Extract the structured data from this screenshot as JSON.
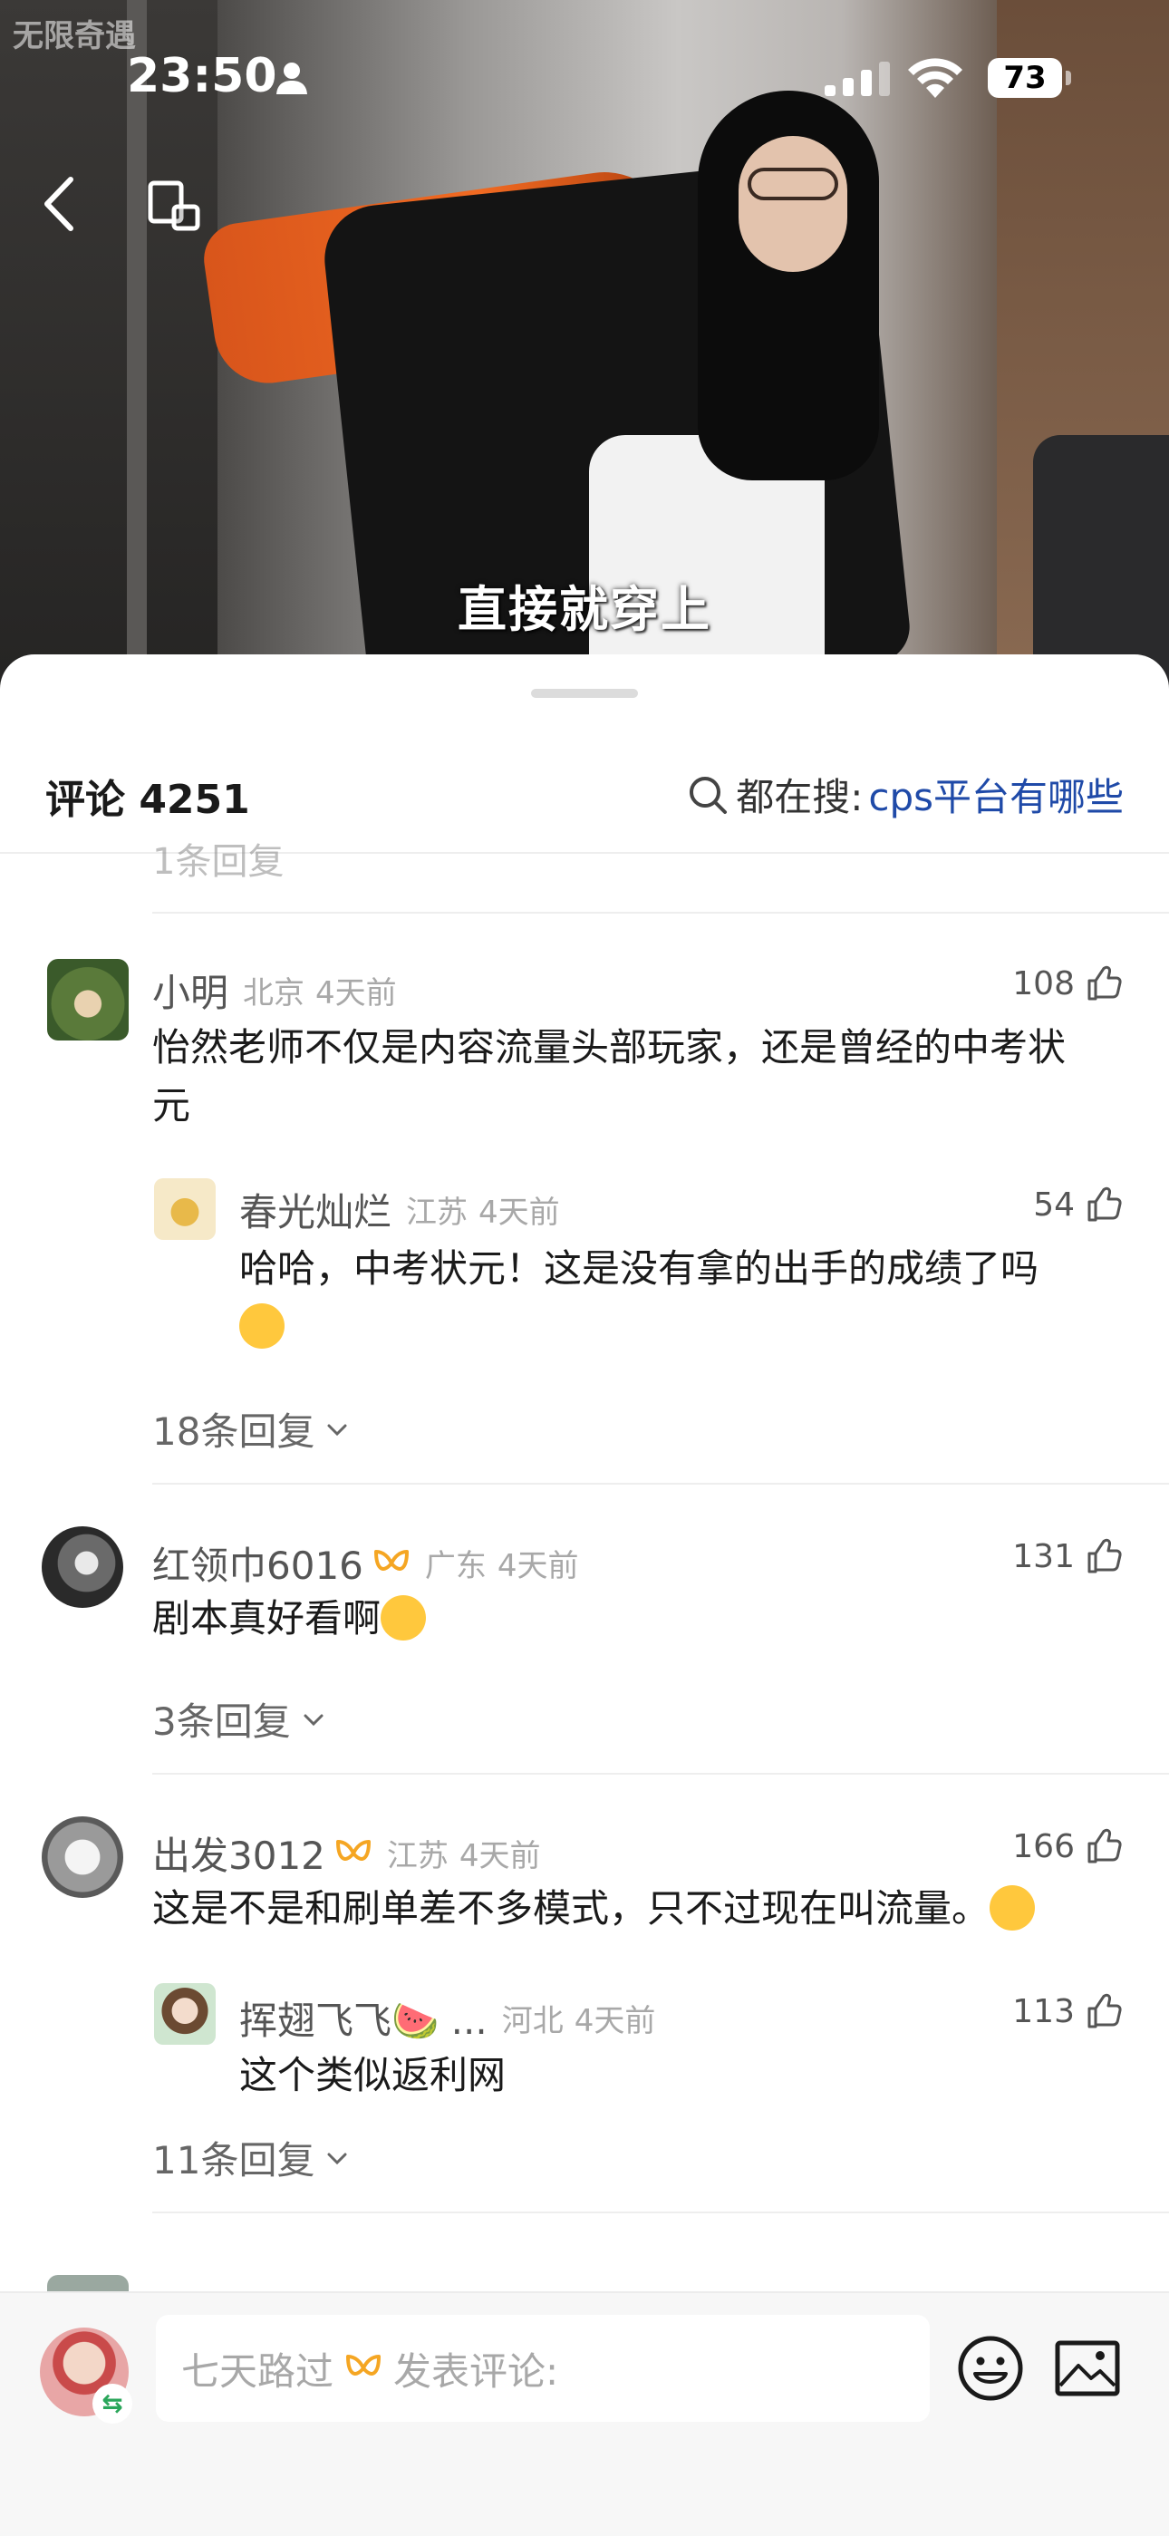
{
  "video": {
    "watermark": "无限奇遇",
    "subtitle": "直接就穿上"
  },
  "status_bar": {
    "time": "23:50",
    "battery": "73"
  },
  "comments_header": {
    "count_label": "评论 4251",
    "search_prefix": "都在搜:",
    "search_keyword": "cps平台有哪些"
  },
  "partial_row": "1条回复",
  "comments": [
    {
      "name": "小明",
      "location": "北京",
      "time": "4天前",
      "likes": "108",
      "text_line1": "怡然老师不仅是内容流量头部玩家，还是曾经的中考状",
      "text_line2": "元",
      "reply": {
        "name": "春光灿烂",
        "location": "江苏",
        "time": "4天前",
        "likes": "54",
        "text": "哈哈，中考状元！这是没有拿的出手的成绩了吗"
      },
      "replies_label": "18条回复"
    },
    {
      "name": "红领巾6016",
      "location": "广东",
      "time": "4天前",
      "likes": "131",
      "text": "剧本真好看啊",
      "replies_label": "3条回复"
    },
    {
      "name": "出发3012",
      "location": "江苏",
      "time": "4天前",
      "likes": "166",
      "text": "这是不是和刷单差不多模式，只不过现在叫流量。",
      "reply": {
        "name": "挥翅飞飞🍉 ...",
        "location": "河北",
        "time": "4天前",
        "likes": "113",
        "text": "这个类似返利网"
      },
      "replies_label": "11条回复"
    }
  ],
  "input_bar": {
    "user_name": "七天路过",
    "placeholder": "发表评论:"
  },
  "colors": {
    "link_blue": "#1f4aa8",
    "vip_orange": "#f5a623",
    "meta_gray": "#a8a8a8"
  }
}
